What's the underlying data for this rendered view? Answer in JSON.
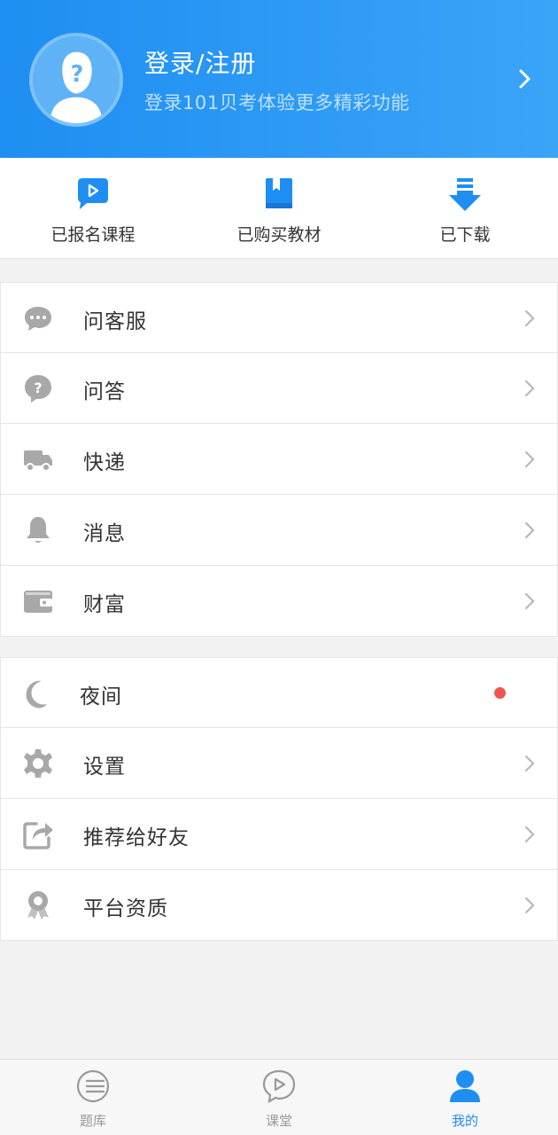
{
  "header": {
    "title": "登录/注册",
    "subtitle": "登录101贝考体验更多精彩功能"
  },
  "quick_actions": [
    {
      "label": "已报名课程",
      "icon": "video-chat-icon"
    },
    {
      "label": "已购买教材",
      "icon": "book-icon"
    },
    {
      "label": "已下载",
      "icon": "download-icon"
    }
  ],
  "menu_group_1": [
    {
      "label": "问客服",
      "icon": "customer-service-icon"
    },
    {
      "label": "问答",
      "icon": "question-icon"
    },
    {
      "label": "快递",
      "icon": "truck-icon"
    },
    {
      "label": "消息",
      "icon": "bell-icon"
    },
    {
      "label": "财富",
      "icon": "wallet-icon"
    }
  ],
  "menu_group_2": [
    {
      "label": "夜间",
      "icon": "moon-icon",
      "has_dot": true
    },
    {
      "label": "设置",
      "icon": "gear-icon"
    },
    {
      "label": "推荐给好友",
      "icon": "share-icon"
    },
    {
      "label": "平台资质",
      "icon": "award-icon"
    }
  ],
  "tabbar": [
    {
      "label": "题库",
      "icon": "list-icon",
      "active": false
    },
    {
      "label": "课堂",
      "icon": "play-chat-icon",
      "active": false
    },
    {
      "label": "我的",
      "icon": "user-icon",
      "active": true
    }
  ],
  "colors": {
    "primary": "#1e8ef2",
    "icon_gray": "#a8a8a8",
    "dot": "#ee5555"
  }
}
